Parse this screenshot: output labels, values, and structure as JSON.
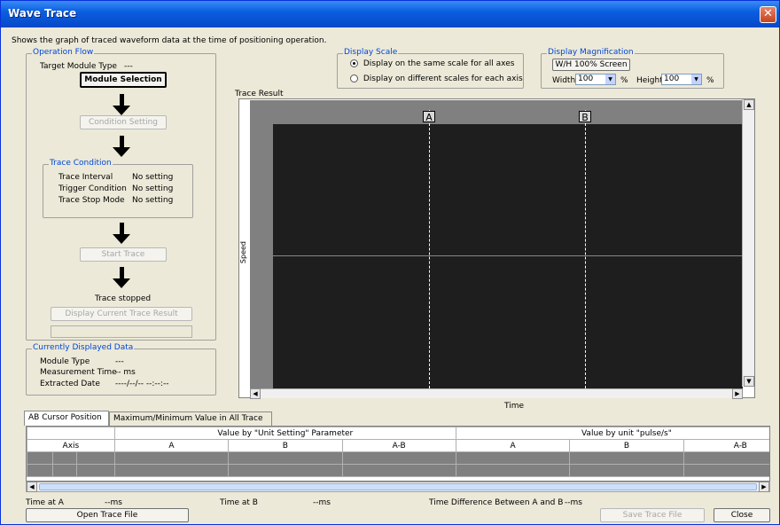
{
  "window": {
    "title": "Wave Trace",
    "close_glyph": "✕"
  },
  "description": "Shows the graph of traced waveform data at the time of positioning operation.",
  "operation_flow": {
    "legend": "Operation Flow",
    "target_module_label": "Target Module Type",
    "target_module_value": "---",
    "module_selection_button": "Module Selection",
    "condition_setting_button": "Condition Setting",
    "trace_condition": {
      "legend": "Trace Condition",
      "rows": [
        {
          "label": "Trace Interval",
          "value": "No setting"
        },
        {
          "label": "Trigger Condition",
          "value": "No setting"
        },
        {
          "label": "Trace Stop Mode",
          "value": "No setting"
        }
      ]
    },
    "start_trace_button": "Start Trace",
    "status": "Trace stopped",
    "display_current_button": "Display Current Trace Result"
  },
  "currently_displayed": {
    "legend": "Currently Displayed Data",
    "rows": [
      {
        "label": "Module Type",
        "value": "---"
      },
      {
        "label": "Measurement Time",
        "value": "-- ms"
      },
      {
        "label": "Extracted Date",
        "value": "----/--/-- --:--:--"
      }
    ]
  },
  "display_scale": {
    "legend": "Display Scale",
    "option_same": "Display on the same scale for all axes",
    "option_different": "Display on different scales for each axis",
    "selected": "same"
  },
  "display_magnification": {
    "legend": "Display Magnification",
    "wh_button": "W/H 100% Screen",
    "width_label": "Width",
    "width_value": "100",
    "height_label": "Height",
    "height_value": "100",
    "unit": "%"
  },
  "trace_result": {
    "label": "Trace Result",
    "y_label": "Speed",
    "x_label": "Time",
    "cursor_a": "A",
    "cursor_b": "B"
  },
  "tabs": [
    "AB Cursor Position",
    "Maximum/Minimum Value in All Trace Data"
  ],
  "grid": {
    "group1": "Value by \"Unit Setting\" Parameter",
    "group2": "Value by unit  \"pulse/s\"",
    "axis": "Axis",
    "cols": [
      "A",
      "B",
      "A-B",
      "A",
      "B",
      "A-B"
    ]
  },
  "footer": {
    "time_a_label": "Time at A",
    "time_a_value": "--ms",
    "time_b_label": "Time at B",
    "time_b_value": "--ms",
    "time_diff_label": "Time Difference Between A and B",
    "time_diff_value": "--ms",
    "open_button": "Open Trace File",
    "save_button": "Save Trace File",
    "close_button": "Close"
  },
  "colors": {
    "title_bar": "#0a5fe0",
    "group_legend": "#0046d5",
    "plot_bg": "#1e1e1e",
    "plot_frame": "#808080"
  }
}
